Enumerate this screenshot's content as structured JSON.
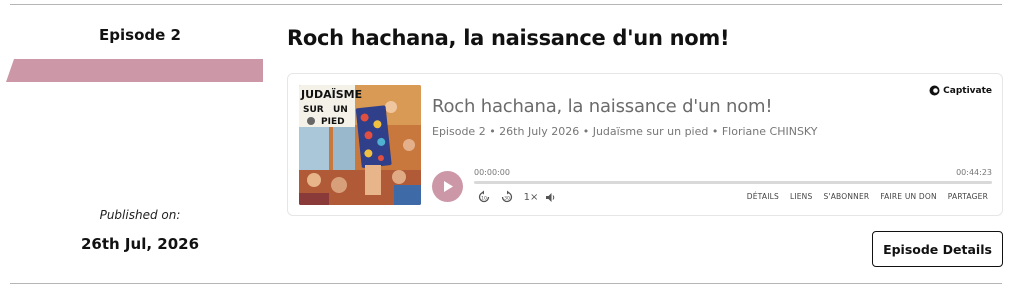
{
  "sidebar": {
    "episode_label": "Episode 2",
    "published_label": "Published on:",
    "published_date": "26th Jul, 2026"
  },
  "episode": {
    "title": "Roch hachana, la naissance d'un nom!"
  },
  "player": {
    "brand": "Captivate",
    "title": "Roch hachana, la naissance d'un nom!",
    "meta": "Episode 2 • 26th July 2026 • Judaïsme sur un pied • Floriane CHINSKY",
    "cover_text": {
      "line1": "JUDAÏSME",
      "line2a": "SUR",
      "line2b": "UN",
      "line3": "PIED"
    },
    "time_current": "00:00:00",
    "time_total": "00:44:23",
    "progress": 0,
    "speed": "1×",
    "menu": [
      "DÉTAILS",
      "LIENS",
      "S'ABONNER",
      "FAIRE UN DON",
      "PARTAGER"
    ]
  },
  "actions": {
    "details_button": "Episode Details"
  },
  "colors": {
    "accent": "#cc98a7",
    "text": "#111111",
    "muted": "#6b6b6b",
    "rule": "#b5b5b5"
  }
}
